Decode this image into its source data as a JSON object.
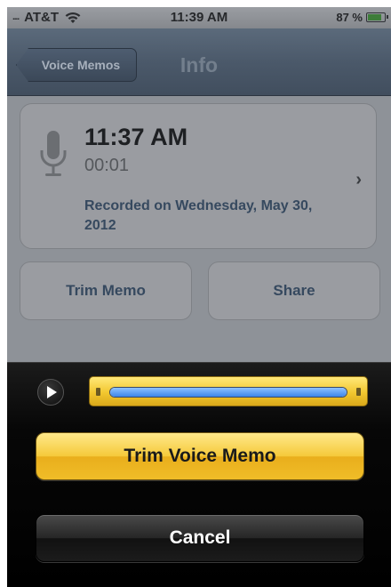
{
  "status_bar": {
    "signal": "....",
    "carrier": "AT&T",
    "time": "11:39 AM",
    "battery_percent": "87 %",
    "battery_level": 0.87
  },
  "nav": {
    "back_label": "Voice Memos",
    "title": "Info"
  },
  "memo": {
    "time": "11:37 AM",
    "duration": "00:01",
    "recorded_on": "Recorded on Wednesday, May 30, 2012"
  },
  "actions": {
    "trim_label": "Trim Memo",
    "share_label": "Share"
  },
  "trim_sheet": {
    "selection_fraction": 1.0,
    "trim_button_label": "Trim Voice Memo",
    "cancel_label": "Cancel"
  },
  "icons": {
    "wifi": "wifi-icon",
    "battery": "battery-icon",
    "microphone": "microphone-icon",
    "chevron": "chevron-right-icon",
    "play": "play-icon"
  },
  "colors": {
    "trim_accent": "#f5c93a",
    "nav_bar": "#4b596a",
    "link_text": "#36495f"
  }
}
